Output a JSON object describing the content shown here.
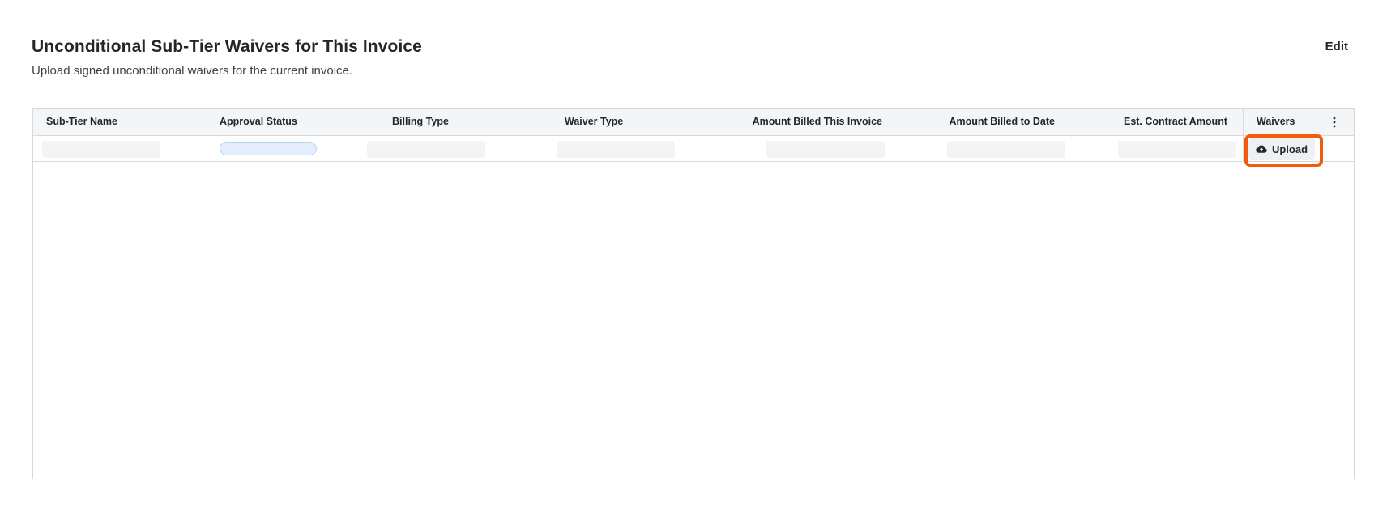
{
  "section": {
    "title": "Unconditional Sub-Tier Waivers for This Invoice",
    "subtitle": "Upload signed unconditional waivers for the current invoice.",
    "edit_label": "Edit"
  },
  "table": {
    "columns": [
      "Sub-Tier Name",
      "Approval Status",
      "Billing Type",
      "Waiver Type",
      "Amount Billed This Invoice",
      "Amount Billed to Date",
      "Est. Contract Amount",
      "Waivers"
    ],
    "rows": [
      {
        "sub_tier_name": "",
        "approval_status": "",
        "billing_type": "",
        "waiver_type": "",
        "amount_billed_this_invoice": "",
        "amount_billed_to_date": "",
        "est_contract_amount": "",
        "waivers_action": "Upload"
      }
    ],
    "loading_placeholder_colors": {
      "skeleton": "#f3f4f5",
      "status_pill": "#e3eefc"
    }
  },
  "icons": {
    "column_menu": "vertical-dots-icon",
    "upload": "cloud-upload-icon"
  },
  "colors": {
    "highlight": "#f25a0f",
    "header_bg": "#f4f5f6"
  }
}
